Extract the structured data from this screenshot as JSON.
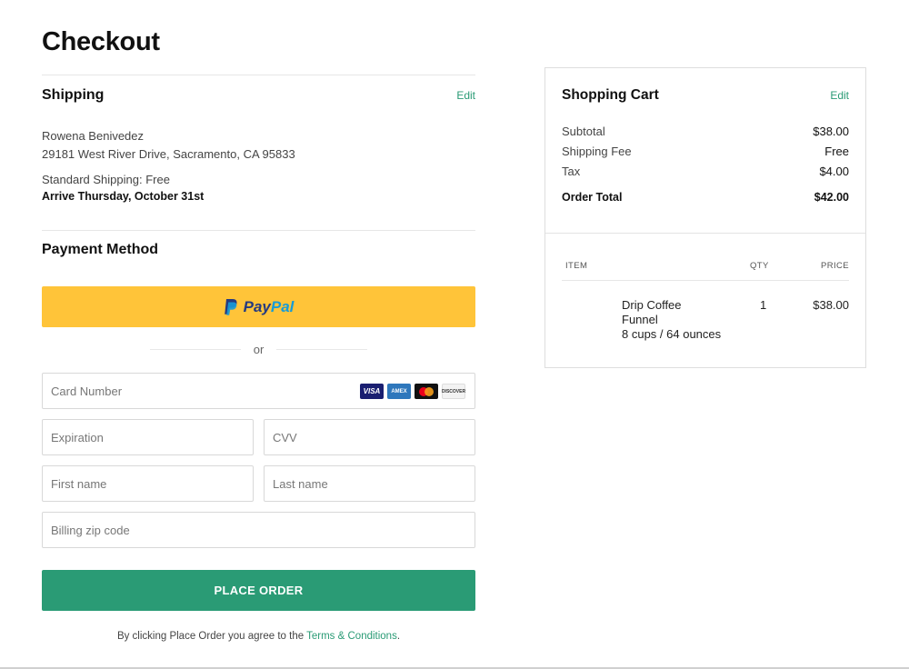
{
  "page": {
    "title": "Checkout"
  },
  "shipping": {
    "title": "Shipping",
    "edit_label": "Edit",
    "name": "Rowena Benivedez",
    "address": "29181 West River Drive, Sacramento, CA 95833",
    "method": "Standard Shipping: Free",
    "arrival": "Arrive Thursday, October 31st"
  },
  "payment": {
    "title": "Payment Method",
    "paypal_pay": "Pay",
    "paypal_pal": "Pal",
    "or_label": "or",
    "card_number_placeholder": "Card Number",
    "expiration_placeholder": "Expiration",
    "cvv_placeholder": "CVV",
    "first_name_placeholder": "First name",
    "last_name_placeholder": "Last name",
    "zip_placeholder": "Billing zip code",
    "card_brands": [
      "VISA",
      "AMEX",
      "mastercard",
      "DISCOVER"
    ]
  },
  "actions": {
    "place_order_label": "PLACE ORDER",
    "terms_prefix": "By clicking Place Order you agree to the ",
    "terms_link": "Terms & Conditions",
    "terms_suffix": "."
  },
  "cart": {
    "title": "Shopping Cart",
    "edit_label": "Edit",
    "subtotal_label": "Subtotal",
    "subtotal_value": "$38.00",
    "shipping_label": "Shipping Fee",
    "shipping_value": "Free",
    "tax_label": "Tax",
    "tax_value": "$4.00",
    "total_label": "Order Total",
    "total_value": "$42.00",
    "columns": {
      "item": "ITEM",
      "qty": "QTY",
      "price": "PRICE"
    },
    "items": [
      {
        "name_line1": "Drip Coffee",
        "name_line2": "Funnel",
        "name_line3": "8 cups / 64 ounces",
        "qty": "1",
        "price": "$38.00"
      }
    ]
  },
  "colors": {
    "accent": "#2a9b75",
    "paypal_yellow": "#ffc439",
    "paypal_blue_dark": "#253b80",
    "paypal_blue_light": "#179bd7"
  }
}
